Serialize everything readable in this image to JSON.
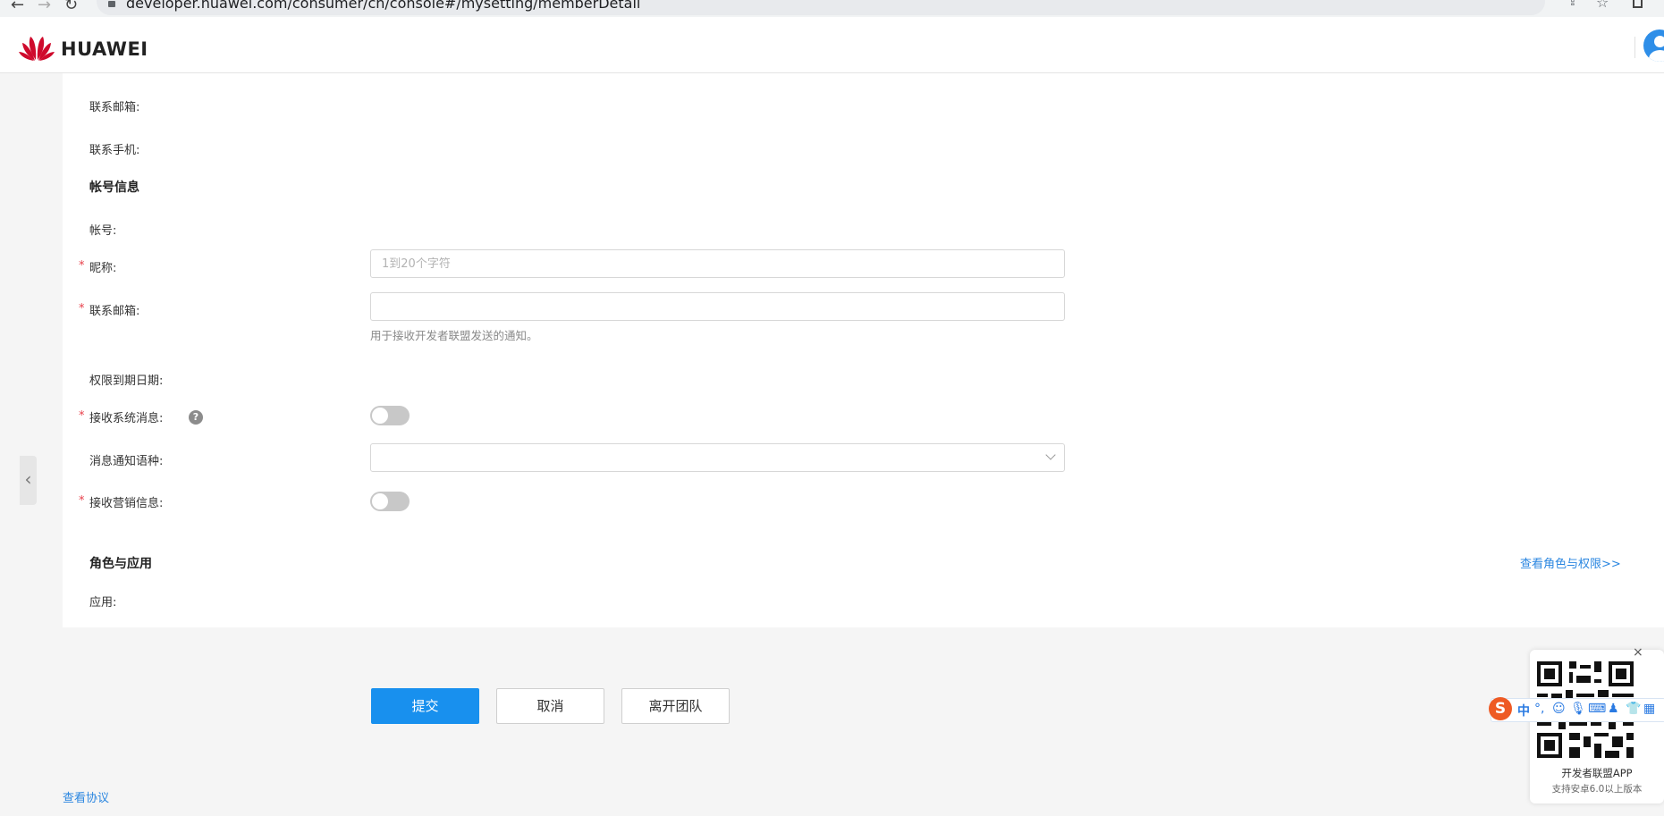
{
  "browser": {
    "url": "developer.huawei.com/consumer/cn/console#/mysetting/memberDetail"
  },
  "header": {
    "brand": "HUAWEI"
  },
  "contact": {
    "email_label": "联系邮箱:",
    "phone_label": "联系手机:"
  },
  "account_section": {
    "title": "帐号信息",
    "account_label": "帐号:",
    "required_mark": "*",
    "nickname_label": "昵称:",
    "nickname_placeholder": "1到20个字符",
    "nickname_value": "",
    "email_label": "联系邮箱:",
    "email_value": "",
    "email_hint": "用于接收开发者联盟发送的通知。",
    "expiry_label": "权限到期日期:",
    "system_msg_label": "接收系统消息:",
    "system_msg_on": false,
    "help_glyph": "?",
    "notify_lang_label": "消息通知语种:",
    "notify_lang_value": "",
    "marketing_label": "接收营销信息:",
    "marketing_on": false
  },
  "roles_section": {
    "title": "角色与应用",
    "view_link": "查看角色与权限>>",
    "app_label": "应用:"
  },
  "actions": {
    "submit": "提交",
    "cancel": "取消",
    "leave_team": "离开团队"
  },
  "footer": {
    "agreement_link": "查看协议"
  },
  "qr_popup": {
    "title": "开发者联盟APP",
    "subtitle": "支持安卓6.0以上版本",
    "close": "×"
  },
  "ime": {
    "logo": "S",
    "mode": "中",
    "punct": "°,"
  },
  "colors": {
    "primary": "#1890ee",
    "link": "#2a86e0",
    "required": "#e8414b",
    "huawei_red": "#cf0a2c"
  }
}
